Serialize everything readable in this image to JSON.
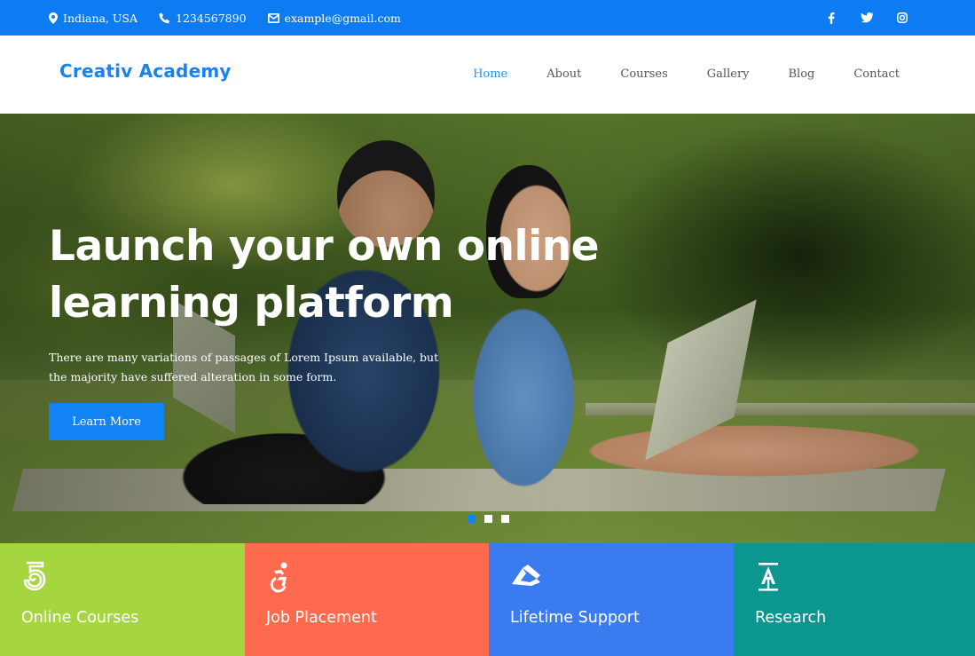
{
  "topbar": {
    "location": "Indiana, USA",
    "phone": "1234567890",
    "email": "example@gmail.com",
    "social": [
      "facebook-icon",
      "twitter-icon",
      "instagram-icon"
    ],
    "color": "#0d7cf2"
  },
  "header": {
    "logo": "Creativ Academy",
    "nav": [
      {
        "label": "Home",
        "active": true
      },
      {
        "label": "About",
        "active": false
      },
      {
        "label": "Courses",
        "active": false
      },
      {
        "label": "Gallery",
        "active": false
      },
      {
        "label": "Blog",
        "active": false
      },
      {
        "label": "Contact",
        "active": false
      }
    ]
  },
  "hero": {
    "title_line1": "Launch your own online",
    "title_line2": "learning platform",
    "text": "There are many variations of passages of Lorem Ipsum available, but the majority have suffered alteration in some form.",
    "button": "Learn More",
    "slides": 3,
    "active_slide": 1
  },
  "features": [
    {
      "title": "Online Courses",
      "icon": "spiral-five-icon",
      "color": "#a5d63f"
    },
    {
      "title": "Job Placement",
      "icon": "accessible-icon",
      "color": "#fe6a4e"
    },
    {
      "title": "Lifetime Support",
      "icon": "origami-ribbon-icon",
      "color": "#3b7bf0"
    },
    {
      "title": "Research",
      "icon": "text-height-icon",
      "color": "#0c9690"
    }
  ]
}
